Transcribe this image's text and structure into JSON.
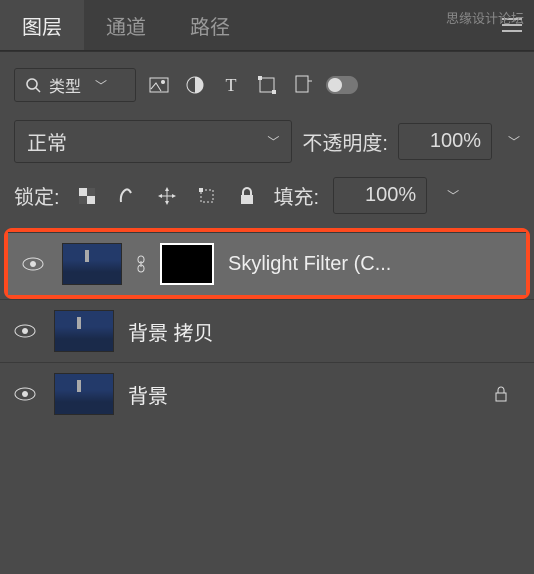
{
  "watermark": "思缘设计论坛",
  "tabs": {
    "layers": "图层",
    "channels": "通道",
    "paths": "路径"
  },
  "filter": {
    "label": "类型"
  },
  "blend": {
    "mode": "正常",
    "opacity_label": "不透明度:",
    "opacity_value": "100%"
  },
  "lock": {
    "label": "锁定:",
    "fill_label": "填充:",
    "fill_value": "100%"
  },
  "layers": [
    {
      "name": "Skylight Filter (C...",
      "selected": true,
      "has_mask": true,
      "locked": false
    },
    {
      "name": "背景 拷贝",
      "selected": false,
      "has_mask": false,
      "locked": false
    },
    {
      "name": "背景",
      "selected": false,
      "has_mask": false,
      "locked": true
    }
  ]
}
